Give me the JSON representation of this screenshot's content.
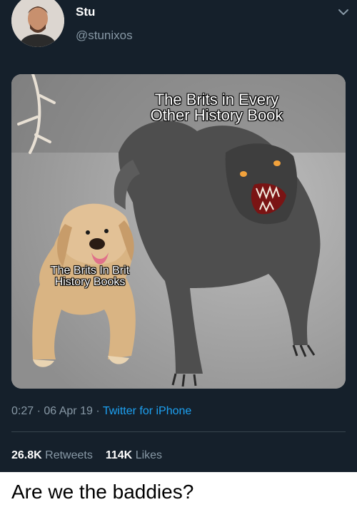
{
  "tweet": {
    "display_name": "Stu",
    "handle": "@stunixos",
    "media": {
      "caption_wolf": "The Brits in Every Other History Book",
      "caption_dog": "The Brits In Brit History Books"
    },
    "time": "0:27",
    "date": "06 Apr 19",
    "source": "Twitter for iPhone",
    "retweets_count": "26.8K",
    "retweets_label": "Retweets",
    "likes_count": "114K",
    "likes_label": "Likes"
  },
  "caption_below": "Are we the baddies?",
  "colors": {
    "background": "#15202b",
    "secondary_text": "#8899a6",
    "link": "#1da1f2"
  }
}
